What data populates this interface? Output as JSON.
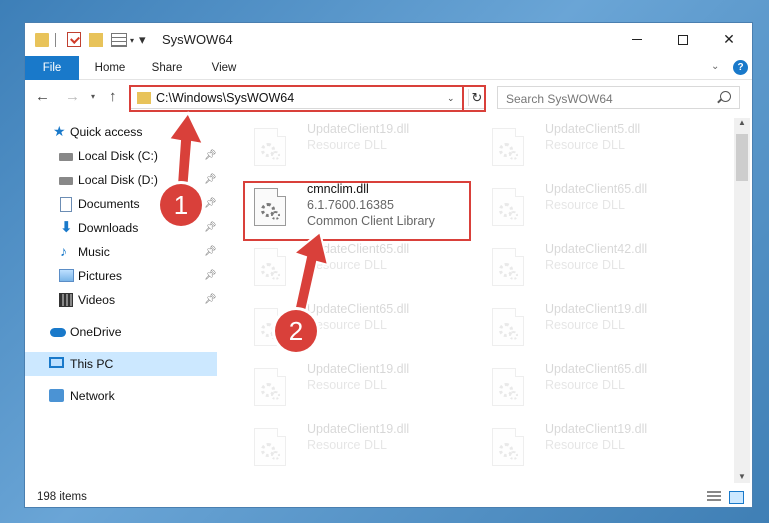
{
  "window": {
    "title": "SysWOW64",
    "ribbon_tabs": [
      "File",
      "Home",
      "Share",
      "View"
    ]
  },
  "nav": {
    "address": "C:\\Windows\\SysWOW64",
    "search_placeholder": "Search SysWOW64"
  },
  "sidebar": {
    "items": [
      {
        "label": "Quick access",
        "icon": "star-icon",
        "pinned": false
      },
      {
        "label": "Local Disk (C:)",
        "icon": "disk-icon",
        "pinned": true
      },
      {
        "label": "Local Disk (D:)",
        "icon": "disk-icon",
        "pinned": true
      },
      {
        "label": "Documents",
        "icon": "documents-icon",
        "pinned": true
      },
      {
        "label": "Downloads",
        "icon": "download-icon",
        "pinned": true
      },
      {
        "label": "Music",
        "icon": "music-icon",
        "pinned": true
      },
      {
        "label": "Pictures",
        "icon": "pictures-icon",
        "pinned": true
      },
      {
        "label": "Videos",
        "icon": "videos-icon",
        "pinned": true
      },
      {
        "label": "OneDrive",
        "icon": "cloud-icon",
        "pinned": false
      },
      {
        "label": "This PC",
        "icon": "pc-icon",
        "pinned": false
      },
      {
        "label": "Network",
        "icon": "network-icon",
        "pinned": false
      }
    ]
  },
  "files": {
    "selected": {
      "name": "cmnclim.dll",
      "version": "6.1.7600.16385",
      "description": "Common Client Library"
    },
    "background": [
      {
        "name": "UpdateClient19.dll",
        "type": "Resource DLL"
      },
      {
        "name": "UpdateClient5.dll",
        "type": "Resource DLL"
      },
      {
        "name": "UpdateClient65.dll",
        "type": "Resource DLL"
      },
      {
        "name": "UpdateClient65.dll",
        "type": "Resource DLL"
      },
      {
        "name": "UpdateClient42.dll",
        "type": "Resource DLL"
      },
      {
        "name": "UpdateClient65.dll",
        "type": "Resource DLL"
      },
      {
        "name": "UpdateClient19.dll",
        "type": "Resource DLL"
      },
      {
        "name": "UpdateClient19.dll",
        "type": "Resource DLL"
      },
      {
        "name": "UpdateClient65.dll",
        "type": "Resource DLL"
      },
      {
        "name": "UpdateClient19.dll",
        "type": "Resource DLL"
      },
      {
        "name": "UpdateClient19.dll",
        "type": "Resource DLL"
      }
    ]
  },
  "status": {
    "item_count": "198 items"
  },
  "annotations": {
    "step1": "1",
    "step2": "2"
  },
  "colors": {
    "accent": "#1979ca",
    "highlight": "#d9403a"
  }
}
